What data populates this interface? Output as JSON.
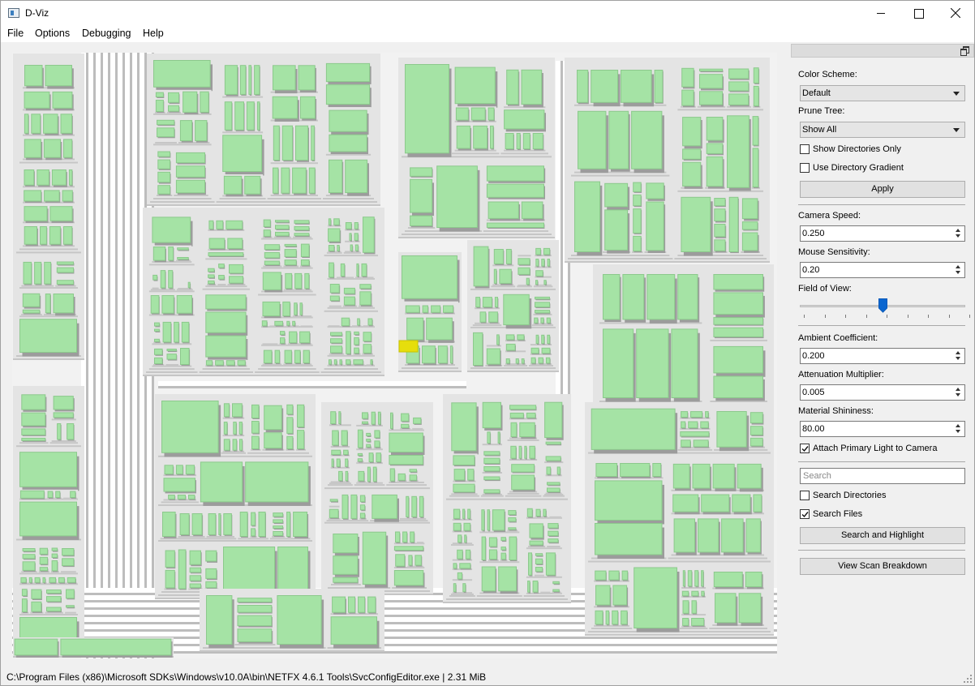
{
  "window": {
    "title": "D-Viz",
    "controls": [
      "minimize",
      "maximize",
      "close"
    ]
  },
  "menu": [
    "File",
    "Options",
    "Debugging",
    "Help"
  ],
  "viewport": {
    "highlight_color": "#e6de0c",
    "block_color": "#a5e3a5",
    "floor_color": "#f2f2f2"
  },
  "panel": {
    "color_scheme_label": "Color Scheme:",
    "color_scheme_value": "Default",
    "prune_tree_label": "Prune Tree:",
    "prune_tree_value": "Show All",
    "show_dirs_only_label": "Show Directories Only",
    "show_dirs_only_checked": false,
    "use_dir_gradient_label": "Use Directory Gradient",
    "use_dir_gradient_checked": false,
    "apply_label": "Apply",
    "camera_speed_label": "Camera Speed:",
    "camera_speed_value": "0.250",
    "mouse_sensitivity_label": "Mouse Sensitivity:",
    "mouse_sensitivity_value": "0.20",
    "fov_label": "Field of View:",
    "fov_fraction": 0.5,
    "ambient_label": "Ambient Coefficient:",
    "ambient_value": "0.200",
    "attenuation_label": "Attenuation Multiplier:",
    "attenuation_value": "0.005",
    "shininess_label": "Material Shininess:",
    "shininess_value": "80.00",
    "attach_light_label": "Attach Primary Light to Camera",
    "attach_light_checked": true,
    "search_placeholder": "Search",
    "search_dirs_label": "Search Directories",
    "search_dirs_checked": false,
    "search_files_label": "Search Files",
    "search_files_checked": true,
    "search_button_label": "Search and Highlight",
    "breakdown_button_label": "View Scan Breakdown"
  },
  "status": {
    "text": "C:\\Program Files (x86)\\Microsoft SDKs\\Windows\\v10.0A\\bin\\NETFX 4.6.1 Tools\\SvcConfigEditor.exe  |  2.31 MiB"
  }
}
